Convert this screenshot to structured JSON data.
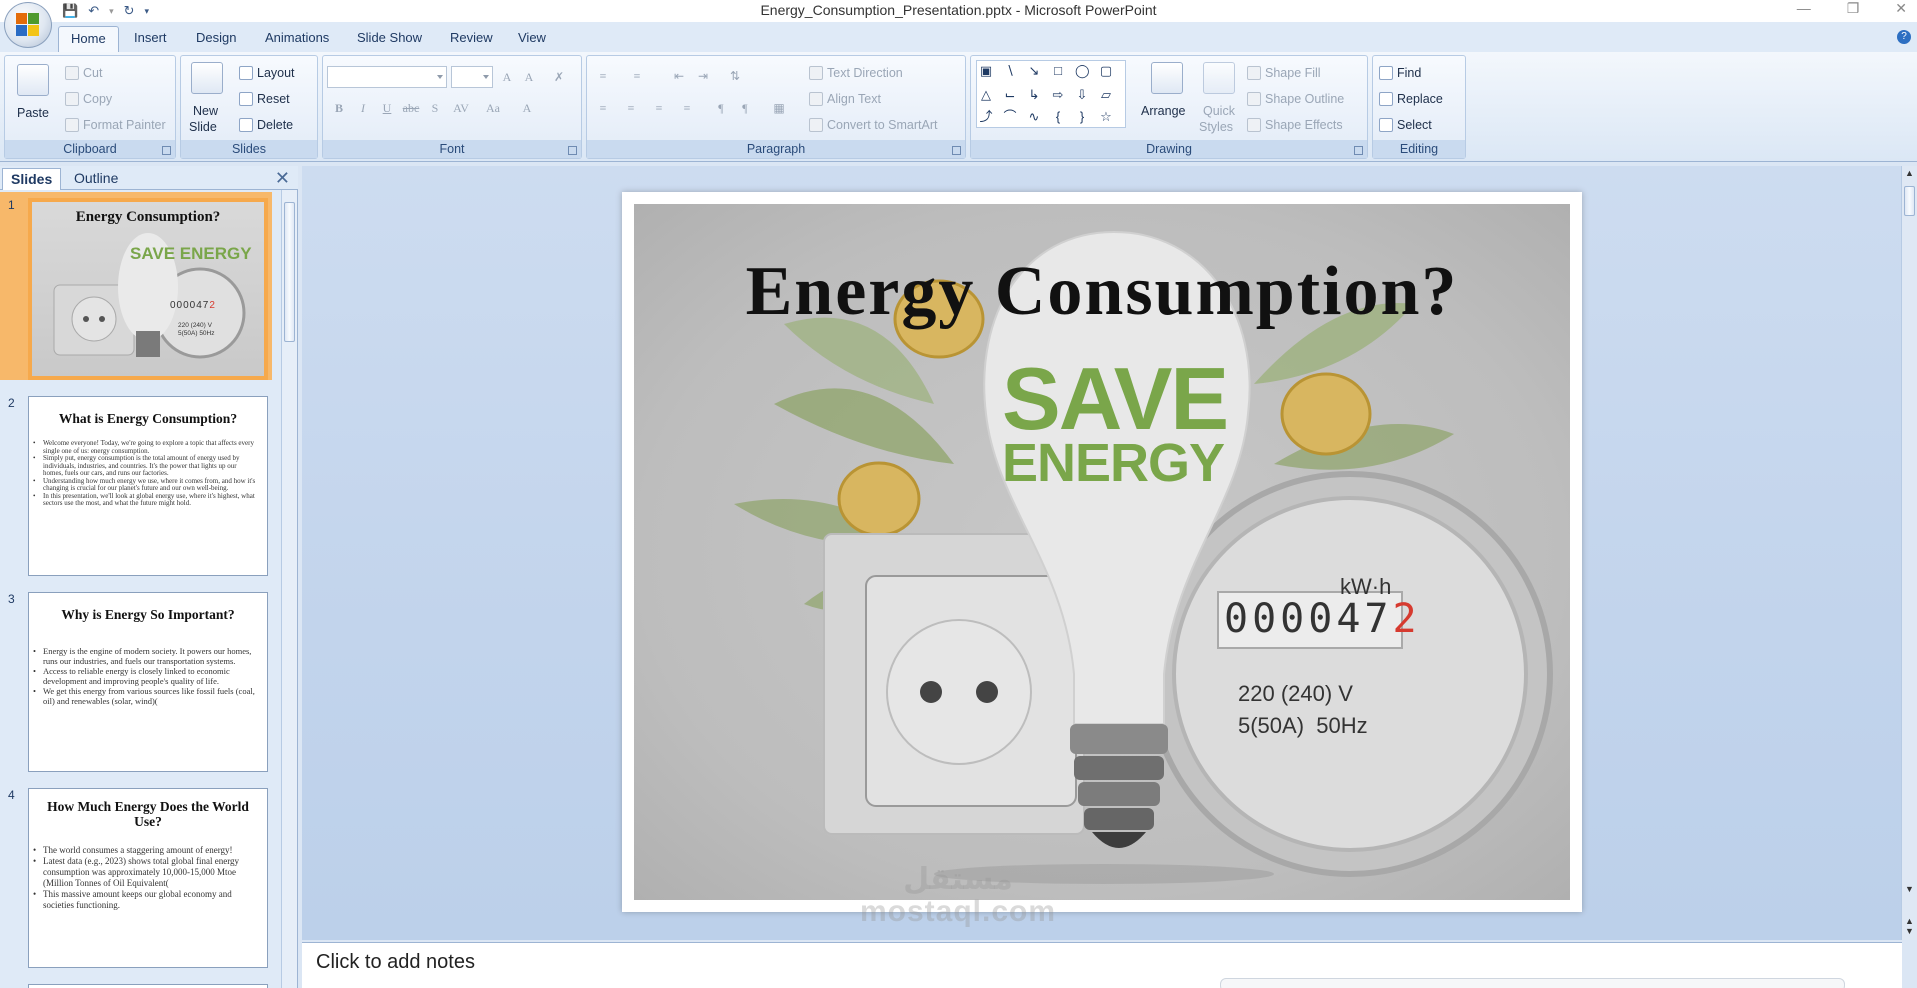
{
  "window": {
    "title": "Energy_Consumption_Presentation.pptx - Microsoft PowerPoint"
  },
  "tabs": [
    "Home",
    "Insert",
    "Design",
    "Animations",
    "Slide Show",
    "Review",
    "View"
  ],
  "ribbon": {
    "clipboard": {
      "label": "Clipboard",
      "paste": "Paste",
      "cut": "Cut",
      "copy": "Copy",
      "format_painter": "Format Painter"
    },
    "slides": {
      "label": "Slides",
      "new_slide": "New",
      "new_slide_2": "Slide",
      "layout": "Layout",
      "reset": "Reset",
      "delete": "Delete"
    },
    "font": {
      "label": "Font"
    },
    "paragraph": {
      "label": "Paragraph",
      "text_direction": "Text Direction",
      "align_text": "Align Text",
      "smartart": "Convert to SmartArt"
    },
    "drawing": {
      "label": "Drawing",
      "arrange": "Arrange",
      "quick_styles": "Quick",
      "quick_styles_2": "Styles",
      "shape_fill": "Shape Fill",
      "shape_outline": "Shape Outline",
      "shape_effects": "Shape Effects"
    },
    "editing": {
      "label": "Editing",
      "find": "Find",
      "replace": "Replace",
      "select": "Select"
    }
  },
  "panel": {
    "tab_slides": "Slides",
    "tab_outline": "Outline"
  },
  "thumbnails": [
    {
      "num": "1",
      "title": "Energy Consumption?",
      "art_text": "SAVE ENERGY",
      "meter_digits": "000047",
      "meter_last": "2",
      "meter_v": "220 (240) V",
      "meter_hz": "5(50A) 50Hz"
    },
    {
      "num": "2",
      "title": "What is Energy Consumption?",
      "bullets": [
        "Welcome everyone! Today, we're going to explore a topic that affects every single one of us: energy consumption.",
        "Simply put, energy consumption is the total amount of energy used by individuals, industries, and countries. It's the power that lights up our homes, fuels our cars, and runs our factories.",
        "Understanding how much energy we use, where it comes from, and how it's changing is crucial for our planet's future and our own well-being.",
        "In this presentation, we'll look at global energy use, where it's highest, what sectors use the most, and what the future might hold."
      ]
    },
    {
      "num": "3",
      "title": "Why is Energy So Important?",
      "bullets": [
        "Energy is the engine of modern society. It powers our homes, runs our industries, and fuels our transportation systems.",
        "Access to reliable energy is closely linked to economic development and improving people's quality of life.",
        "We get this energy from various sources like fossil fuels (coal, oil) and renewables (solar, wind)("
      ]
    },
    {
      "num": "4",
      "title": "How Much Energy Does the World Use?",
      "bullets": [
        "The world consumes a staggering amount of energy!",
        "Latest data (e.g., 2023) shows total global final energy consumption was approximately 10,000-15,000 Mtoe (Million Tonnes of Oil Equivalent(",
        "This massive amount keeps our global economy and societies functioning."
      ]
    }
  ],
  "slide": {
    "title": "Energy Consumption?",
    "art_line1": "SAVE",
    "art_line2": "ENERGY",
    "meter_unit": "kW·h",
    "meter_digits": "000047",
    "meter_last": "2",
    "meter_v": "220 (240) V",
    "meter_hz": "5(50A)  50Hz"
  },
  "notes": {
    "placeholder": "Click to add notes"
  },
  "watermark": {
    "arabic": "مستقل",
    "latin": "mostaql.com"
  },
  "colors": {
    "ribbon_bg": "#dbe7f5",
    "accent": "#2b5797",
    "save_energy_green": "#7aa64a",
    "meter_red": "#d63a2f"
  }
}
